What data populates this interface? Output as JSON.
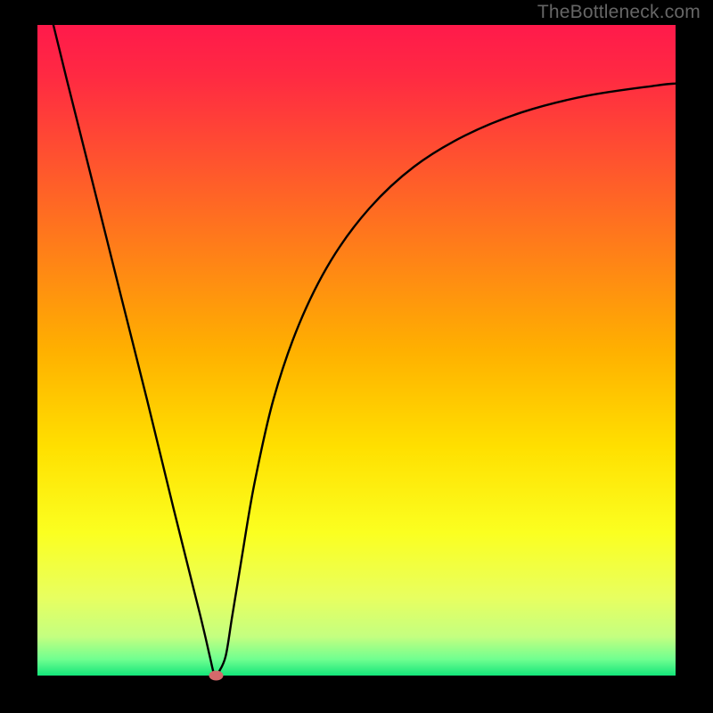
{
  "watermark": "TheBottleneck.com",
  "colors": {
    "frame": "#000000",
    "curve_stroke": "#000000",
    "marker_fill": "#d5696b",
    "gradient_stops": [
      {
        "offset": 0.0,
        "color": "#ff1a4b"
      },
      {
        "offset": 0.08,
        "color": "#ff2a42"
      },
      {
        "offset": 0.2,
        "color": "#ff5030"
      },
      {
        "offset": 0.35,
        "color": "#ff8018"
      },
      {
        "offset": 0.5,
        "color": "#ffb000"
      },
      {
        "offset": 0.65,
        "color": "#ffe000"
      },
      {
        "offset": 0.78,
        "color": "#fbff20"
      },
      {
        "offset": 0.88,
        "color": "#e8ff60"
      },
      {
        "offset": 0.94,
        "color": "#c4ff80"
      },
      {
        "offset": 0.975,
        "color": "#70ff90"
      },
      {
        "offset": 1.0,
        "color": "#14e57a"
      }
    ]
  },
  "chart_data": {
    "type": "line",
    "title": "",
    "xlabel": "",
    "ylabel": "",
    "xlim": [
      0,
      100
    ],
    "ylim": [
      0,
      100
    ],
    "legend_position": "none",
    "series": [
      {
        "name": "curve",
        "x": [
          2.5,
          4.6,
          8.8,
          13.0,
          17.2,
          21.3,
          25.5,
          27.0,
          27.6,
          28.0,
          28.4,
          29.5,
          30.5,
          32.0,
          34.0,
          37.0,
          41.0,
          46.0,
          52.0,
          59.0,
          67.0,
          76.0,
          86.0,
          97.0,
          100.0
        ],
        "values": [
          100.0,
          91.6,
          75.2,
          58.7,
          42.3,
          25.8,
          9.3,
          3.0,
          0.5,
          0.0,
          0.5,
          3.0,
          9.0,
          18.0,
          29.5,
          42.5,
          54.0,
          63.8,
          71.8,
          78.2,
          83.0,
          86.6,
          89.1,
          90.7,
          91.0
        ]
      }
    ],
    "marker": {
      "x": 28.0,
      "y": 0.0
    }
  }
}
